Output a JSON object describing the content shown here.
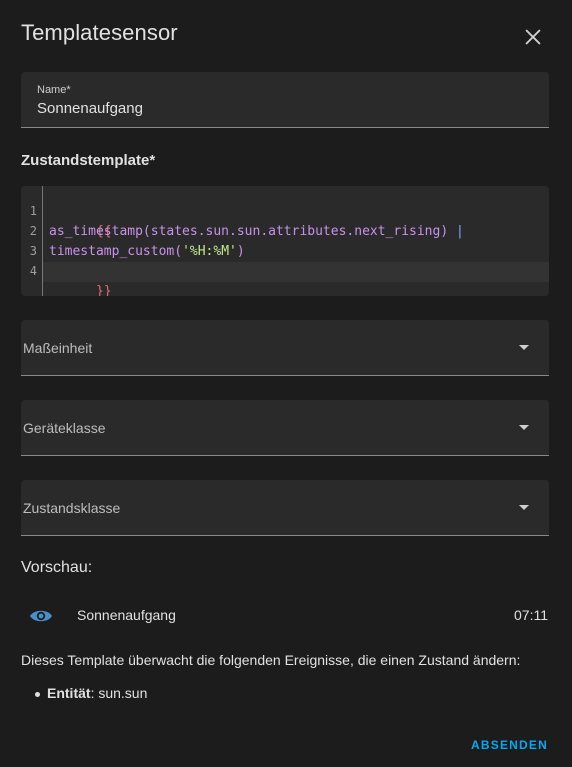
{
  "dialog": {
    "title": "Templatesensor",
    "close_icon": "close-icon"
  },
  "name_field": {
    "label": "Name*",
    "value": "Sonnenaufgang"
  },
  "state_template": {
    "label": "Zustandstemplate*",
    "line_numbers": [
      "1",
      "2",
      "3",
      "4"
    ],
    "lines": [
      "{{",
      "as_timestamp(states.sun.sun.attributes.next_rising) |",
      "timestamp_custom('%H:%M')",
      "}}"
    ],
    "line2_text": "as_timestamp(states.sun.sun.attributes.next_rising) ",
    "line2_pipe": "|",
    "line3_fn": "timestamp_custom(",
    "line3_str": "'%H:%M'",
    "line3_end": ")"
  },
  "selects": {
    "unit": "Maßeinheit",
    "device_class": "Geräteklasse",
    "state_class": "Zustandsklasse"
  },
  "preview": {
    "title": "Vorschau:",
    "icon": "eye-icon",
    "entity_name": "Sonnenaufgang",
    "state": "07:11"
  },
  "events": {
    "info": "Dieses Template überwacht die folgenden Ereignisse, die einen Zustand ändern:",
    "entity_label": "Entität",
    "entity_sep": ": ",
    "entity_value": "sun.sun"
  },
  "actions": {
    "submit": "ABSENDEN"
  },
  "colors": {
    "background": "#1c1c1c",
    "field": "#2a2a2a",
    "accent": "#03a9f4",
    "icon": "#4a90c8"
  }
}
